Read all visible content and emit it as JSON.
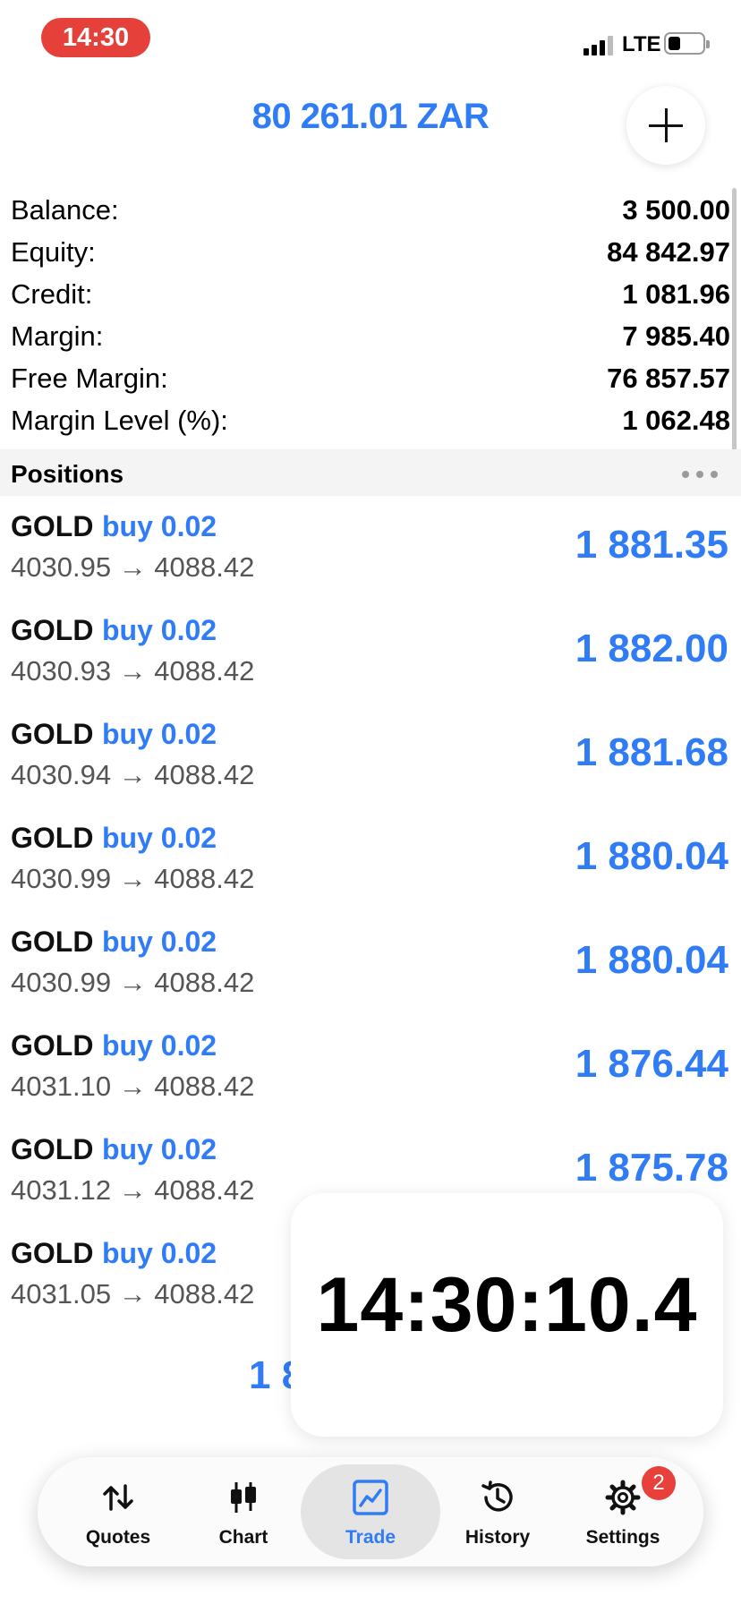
{
  "status_bar": {
    "time": "14:30",
    "network": "LTE"
  },
  "header": {
    "balance_display": "80 261.01 ZAR"
  },
  "summary": [
    {
      "label": "Balance:",
      "value": "3 500.00"
    },
    {
      "label": "Equity:",
      "value": "84 842.97"
    },
    {
      "label": "Credit:",
      "value": "1 081.96"
    },
    {
      "label": "Margin:",
      "value": "7 985.40"
    },
    {
      "label": "Free Margin:",
      "value": "76 857.57"
    },
    {
      "label": "Margin Level (%):",
      "value": "1 062.48"
    }
  ],
  "positions": {
    "title": "Positions",
    "items": [
      {
        "symbol": "GOLD",
        "direction": "buy 0.02",
        "prices": "4030.95 → 4088.42",
        "profit": "1 881.35"
      },
      {
        "symbol": "GOLD",
        "direction": "buy 0.02",
        "prices": "4030.93 → 4088.42",
        "profit": "1 882.00"
      },
      {
        "symbol": "GOLD",
        "direction": "buy 0.02",
        "prices": "4030.94 → 4088.42",
        "profit": "1 881.68"
      },
      {
        "symbol": "GOLD",
        "direction": "buy 0.02",
        "prices": "4030.99 → 4088.42",
        "profit": "1 880.04"
      },
      {
        "symbol": "GOLD",
        "direction": "buy 0.02",
        "prices": "4030.99 → 4088.42",
        "profit": "1 880.04"
      },
      {
        "symbol": "GOLD",
        "direction": "buy 0.02",
        "prices": "4031.10 → 4088.42",
        "profit": "1 876.44"
      },
      {
        "symbol": "GOLD",
        "direction": "buy 0.02",
        "prices": "4031.12 → 4088.42",
        "profit": "1 875.78"
      },
      {
        "symbol": "GOLD",
        "direction": "buy 0.02",
        "prices": "4031.05 → 4088.42",
        "profit": ""
      }
    ],
    "partial_profit": "1 8"
  },
  "clock_overlay": {
    "time": "14:30:10.4"
  },
  "tab_bar": {
    "tabs": [
      {
        "label": "Quotes",
        "icon": "arrows-up-down-icon"
      },
      {
        "label": "Chart",
        "icon": "candlestick-icon"
      },
      {
        "label": "Trade",
        "icon": "trade-chart-icon"
      },
      {
        "label": "History",
        "icon": "history-clock-icon"
      },
      {
        "label": "Settings",
        "icon": "gear-icon",
        "badge": "2"
      }
    ],
    "active": "Trade"
  },
  "colors": {
    "accent": "#2f7cf6",
    "status_pill": "#e5403a",
    "badge": "#e8403a"
  }
}
